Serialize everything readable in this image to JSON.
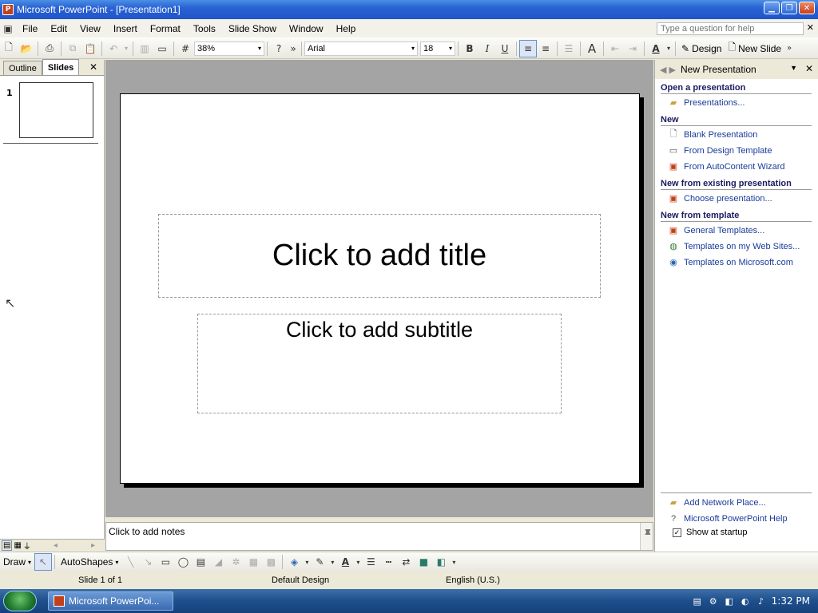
{
  "window": {
    "title": "Microsoft PowerPoint - [Presentation1]",
    "app_icon": "P"
  },
  "menu": {
    "items": [
      "File",
      "Edit",
      "View",
      "Insert",
      "Format",
      "Tools",
      "Slide Show",
      "Window",
      "Help"
    ],
    "help_placeholder": "Type a question for help"
  },
  "toolbar": {
    "zoom": "38%",
    "font": "Arial",
    "font_size": "18",
    "bold": "B",
    "italic": "I",
    "underline": "U",
    "design_label": "Design",
    "new_slide_label": "New Slide"
  },
  "left_pane": {
    "tabs": [
      "Outline",
      "Slides"
    ],
    "active_tab": "Slides",
    "slide_number": "1"
  },
  "slide": {
    "title_placeholder": "Click to add title",
    "subtitle_placeholder": "Click to add subtitle"
  },
  "notes": {
    "placeholder": "Click to add notes"
  },
  "task_pane": {
    "title": "New Presentation",
    "sections": {
      "open": {
        "heading": "Open a presentation",
        "links": [
          "Presentations..."
        ]
      },
      "new": {
        "heading": "New",
        "links": [
          "Blank Presentation",
          "From Design Template",
          "From AutoContent Wizard"
        ]
      },
      "existing": {
        "heading": "New from existing presentation",
        "links": [
          "Choose presentation..."
        ]
      },
      "template": {
        "heading": "New from template",
        "links": [
          "General Templates...",
          "Templates on my Web Sites...",
          "Templates on Microsoft.com"
        ]
      }
    },
    "footer": {
      "links": [
        "Add Network Place...",
        "Microsoft PowerPoint Help"
      ],
      "show_at_startup": "Show at startup",
      "show_at_startup_checked": true
    }
  },
  "draw_toolbar": {
    "draw_label": "Draw",
    "autoshapes_label": "AutoShapes"
  },
  "status": {
    "slide": "Slide 1 of 1",
    "design": "Default Design",
    "language": "English (U.S.)"
  },
  "taskbar": {
    "item_label": "Microsoft PowerPoi...",
    "clock": "1:32 PM"
  }
}
